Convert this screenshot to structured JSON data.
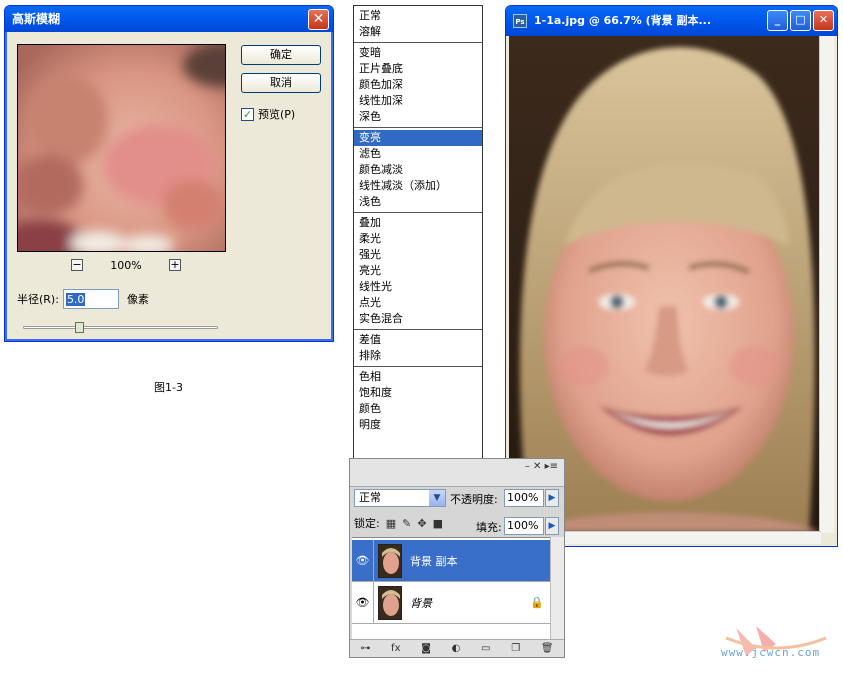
{
  "gaussian_dialog": {
    "title": "高斯模糊",
    "ok_label": "确定",
    "cancel_label": "取消",
    "preview_label": "预览(P)",
    "preview_checked": true,
    "zoom_minus": "−",
    "zoom_value": "100%",
    "zoom_plus": "+",
    "radius_label": "半径(R):",
    "radius_value": "5.0",
    "radius_unit": "像素"
  },
  "caption": "图1-3",
  "blend_modes": {
    "selected": "变亮",
    "groups": [
      [
        "正常",
        "溶解"
      ],
      [
        "变暗",
        "正片叠底",
        "颜色加深",
        "线性加深",
        "深色"
      ],
      [
        "变亮",
        "滤色",
        "颜色减淡",
        "线性减淡（添加）",
        "浅色"
      ],
      [
        "叠加",
        "柔光",
        "强光",
        "亮光",
        "线性光",
        "点光",
        "实色混合"
      ],
      [
        "差值",
        "排除"
      ],
      [
        "色相",
        "饱和度",
        "颜色",
        "明度"
      ]
    ]
  },
  "layers_panel": {
    "blend_mode": "正常",
    "opacity_label": "不透明度:",
    "opacity_value": "100%",
    "lock_label": "锁定:",
    "fill_label": "填充:",
    "fill_value": "100%",
    "layers": [
      {
        "name": "背景 副本",
        "active": true,
        "italic": false,
        "locked": false
      },
      {
        "name": "背景",
        "active": false,
        "italic": true,
        "locked": true
      }
    ]
  },
  "image_window": {
    "title": "1-1a.jpg @ 66.7% (背景 副本...",
    "app_badge": "Ps"
  },
  "watermark": "www.jcwcn.com",
  "colors": {
    "xp_title_blue": "#0058ee",
    "selection_blue": "#316ac5",
    "layer_active": "#3a6fc9"
  }
}
